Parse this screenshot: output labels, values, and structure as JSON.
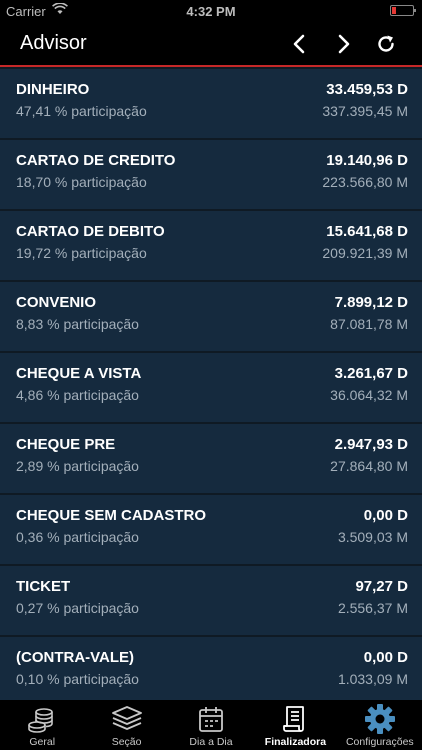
{
  "status_bar": {
    "carrier": "Carrier",
    "time": "4:32 PM"
  },
  "nav": {
    "title": "Advisor"
  },
  "items": [
    {
      "name": "DINHEIRO",
      "pct": "47,41 % participação",
      "value": "33.459,53 D",
      "sub": "337.395,45 M"
    },
    {
      "name": "CARTAO DE CREDITO",
      "pct": "18,70 % participação",
      "value": "19.140,96 D",
      "sub": "223.566,80 M"
    },
    {
      "name": "CARTAO DE DEBITO",
      "pct": "19,72 % participação",
      "value": "15.641,68 D",
      "sub": "209.921,39 M"
    },
    {
      "name": "CONVENIO",
      "pct": "8,83 % participação",
      "value": "7.899,12 D",
      "sub": "87.081,78 M"
    },
    {
      "name": "CHEQUE A VISTA",
      "pct": "4,86 % participação",
      "value": "3.261,67 D",
      "sub": "36.064,32 M"
    },
    {
      "name": "CHEQUE PRE",
      "pct": "2,89 % participação",
      "value": "2.947,93 D",
      "sub": "27.864,80 M"
    },
    {
      "name": "CHEQUE SEM CADASTRO",
      "pct": "0,36 % participação",
      "value": "0,00 D",
      "sub": "3.509,03 M"
    },
    {
      "name": "TICKET",
      "pct": "0,27 % participação",
      "value": "97,27 D",
      "sub": "2.556,37 M"
    },
    {
      "name": "(CONTRA-VALE)",
      "pct": "0,10 % participação",
      "value": "0,00 D",
      "sub": "1.033,09 M"
    }
  ],
  "tabs": [
    {
      "label": "Geral",
      "icon": "coins-icon"
    },
    {
      "label": "Seção",
      "icon": "layers-icon"
    },
    {
      "label": "Dia a Dia",
      "icon": "calendar-icon"
    },
    {
      "label": "Finalizadora",
      "icon": "receipt-icon",
      "active": true
    },
    {
      "label": "Configurações",
      "icon": "gear-icon"
    }
  ],
  "colors": {
    "accent_red": "#c62828",
    "row_bg": "#152a3e",
    "gear_blue": "#4a8fc0"
  }
}
